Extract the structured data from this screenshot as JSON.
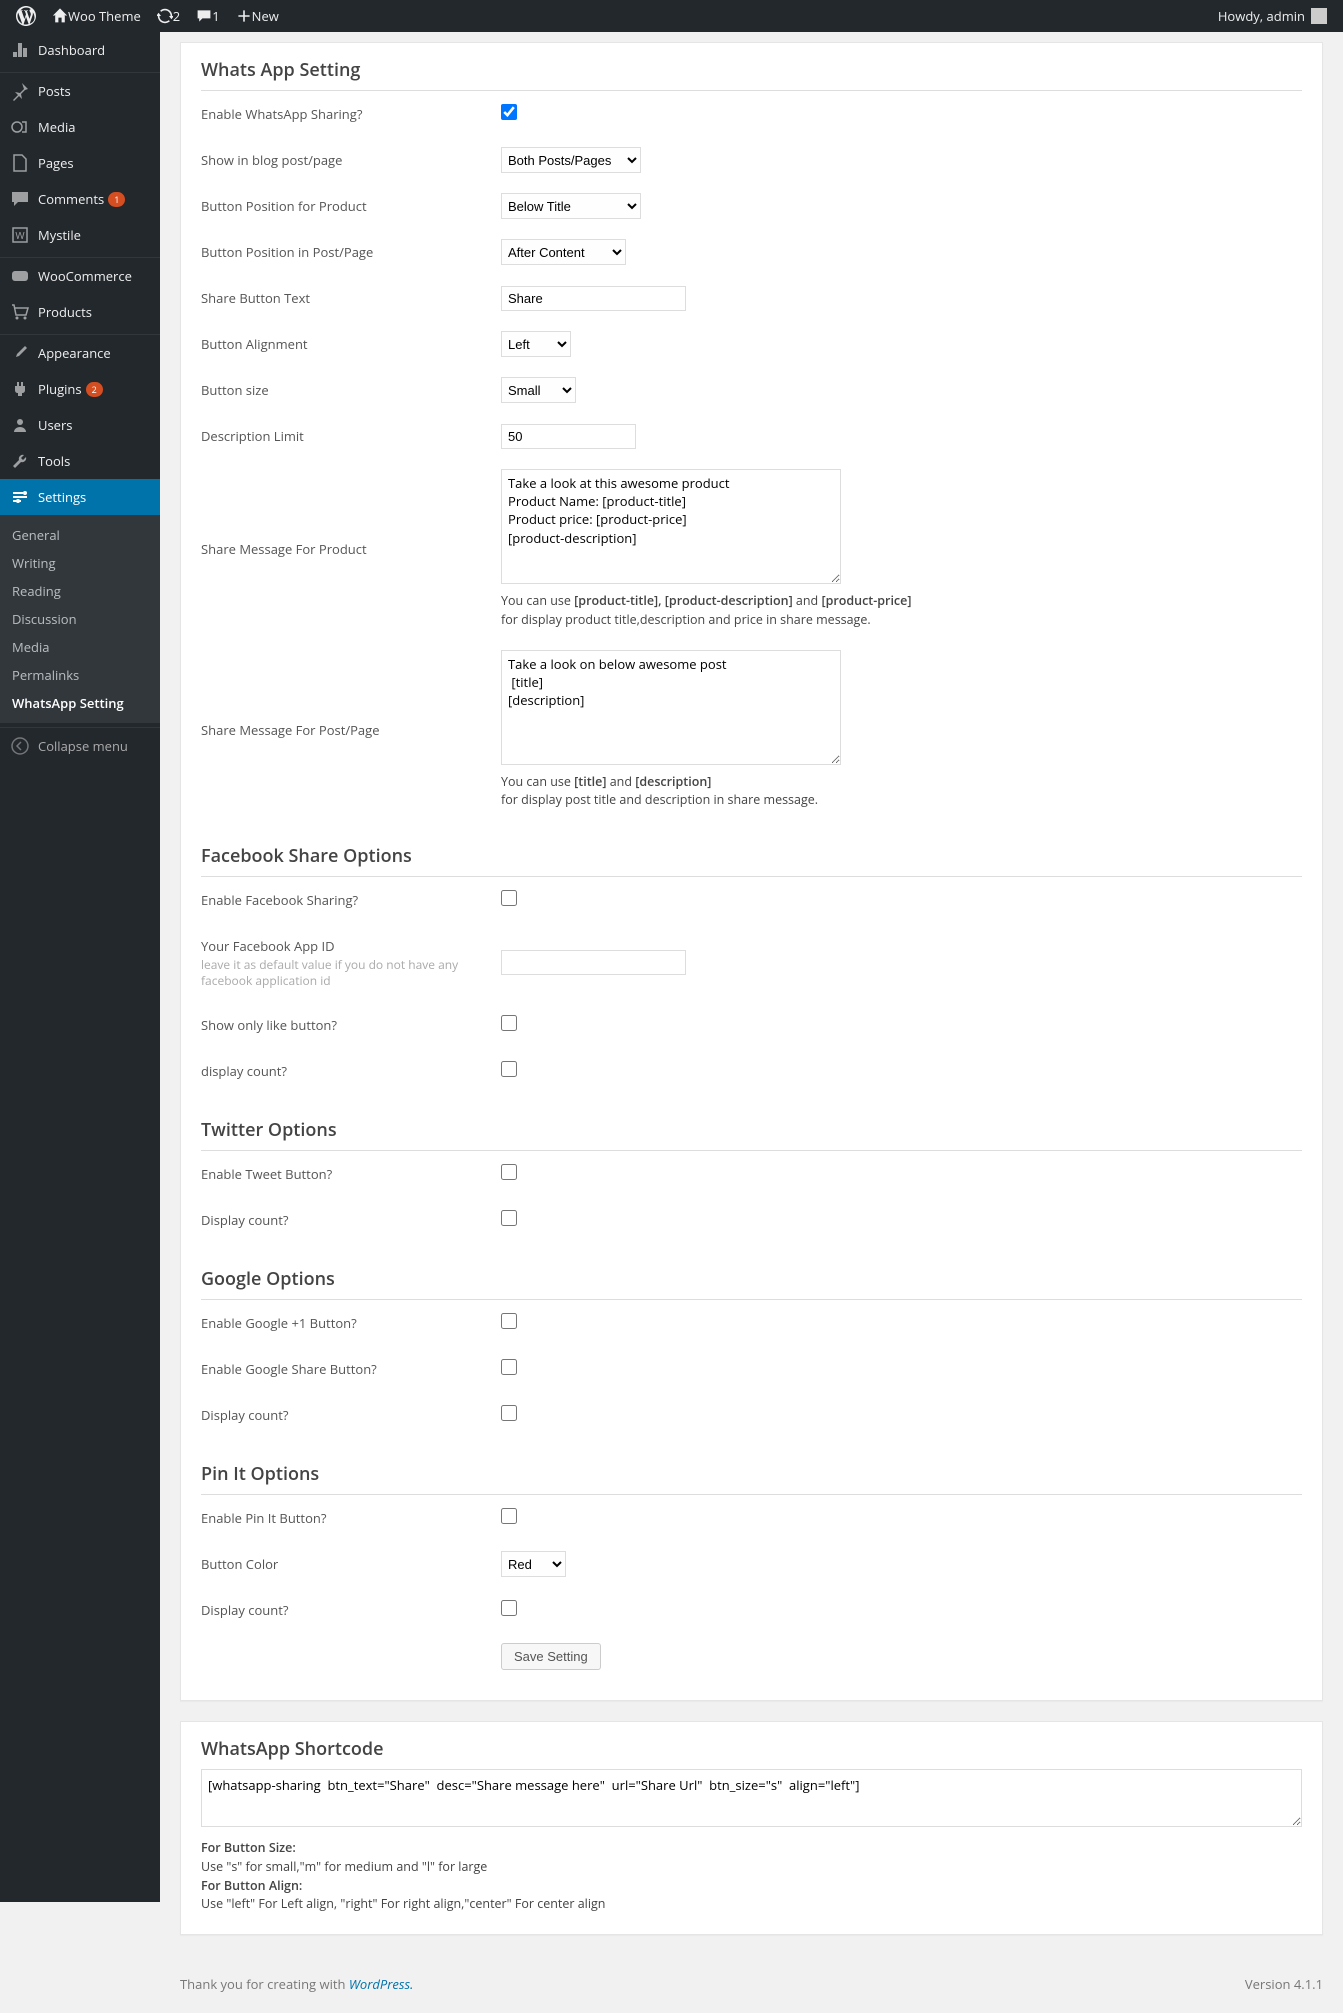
{
  "adminbar": {
    "site_name": "Woo Theme",
    "updates_count": "2",
    "comments_count": "1",
    "new_label": "New",
    "howdy": "Howdy, admin"
  },
  "menu": {
    "dashboard": "Dashboard",
    "posts": "Posts",
    "media": "Media",
    "pages": "Pages",
    "comments": "Comments",
    "comments_badge": "1",
    "mystile": "Mystile",
    "woocommerce": "WooCommerce",
    "products": "Products",
    "appearance": "Appearance",
    "plugins": "Plugins",
    "plugins_badge": "2",
    "users": "Users",
    "tools": "Tools",
    "settings": "Settings",
    "submenu": {
      "general": "General",
      "writing": "Writing",
      "reading": "Reading",
      "discussion": "Discussion",
      "media": "Media",
      "permalinks": "Permalinks",
      "whatsapp": "WhatsApp Setting"
    },
    "collapse": "Collapse menu"
  },
  "whatsapp": {
    "title": "Whats App Setting",
    "enable_label": "Enable WhatsApp Sharing?",
    "show_in_label": "Show in blog post/page",
    "show_in_value": "Both Posts/Pages",
    "btn_pos_product_label": "Button Position for Product",
    "btn_pos_product_value": "Below Title",
    "btn_pos_post_label": "Button Position in Post/Page",
    "btn_pos_post_value": "After Content",
    "share_btn_text_label": "Share Button Text",
    "share_btn_text_value": "Share",
    "btn_align_label": "Button Alignment",
    "btn_align_value": "Left",
    "btn_size_label": "Button size",
    "btn_size_value": "Small",
    "desc_limit_label": "Description Limit",
    "desc_limit_value": "50",
    "msg_product_label": "Share Message For Product",
    "msg_product_value": "Take a look at this awesome product\nProduct Name: [product-title]\nProduct price: [product-price]\n[product-description]",
    "msg_product_help1": "You can use ",
    "msg_product_help_tags": "[product-title], [product-description]",
    "msg_product_help_and": " and ",
    "msg_product_help_tag2": "[product-price]",
    "msg_product_help2": "for display product title,description and price in share message.",
    "msg_post_label": "Share Message For Post/Page",
    "msg_post_value": "Take a look on below awesome post\n [title]\n[description]",
    "msg_post_help1": "You can use ",
    "msg_post_help_tags": "[title]",
    "msg_post_help_and": " and ",
    "msg_post_help_tag2": "[description]",
    "msg_post_help2": "for display post title and description in share message."
  },
  "facebook": {
    "title": "Facebook Share Options",
    "enable_label": "Enable Facebook Sharing?",
    "appid_label": "Your Facebook App ID",
    "appid_desc": "leave it as default value if you do not have any facebook application id",
    "like_label": "Show only like button?",
    "count_label": "display count?"
  },
  "twitter": {
    "title": "Twitter Options",
    "enable_label": "Enable Tweet Button?",
    "count_label": "Display count?"
  },
  "google": {
    "title": "Google Options",
    "plus_label": "Enable Google +1 Button?",
    "share_label": "Enable Google Share Button?",
    "count_label": "Display count?"
  },
  "pinit": {
    "title": "Pin It Options",
    "enable_label": "Enable Pin It Button?",
    "color_label": "Button Color",
    "color_value": "Red",
    "count_label": "Display count?"
  },
  "save_label": "Save Setting",
  "shortcode": {
    "title": "WhatsApp Shortcode",
    "code": "[whatsapp-sharing  btn_text=\"Share\"  desc=\"Share message here\"  url=\"Share Url\"  btn_size=\"s\"  align=\"left\"]",
    "size_label": "For Button Size:",
    "size_desc": "Use \"s\" for small,\"m\" for medium and \"l\" for large",
    "align_label": "For Button Align:",
    "align_desc": "Use \"left\" For Left align, \"right\" For right align,\"center\" For center align"
  },
  "footer": {
    "thanks": "Thank you for creating with ",
    "wp": "WordPress.",
    "version": "Version 4.1.1"
  }
}
